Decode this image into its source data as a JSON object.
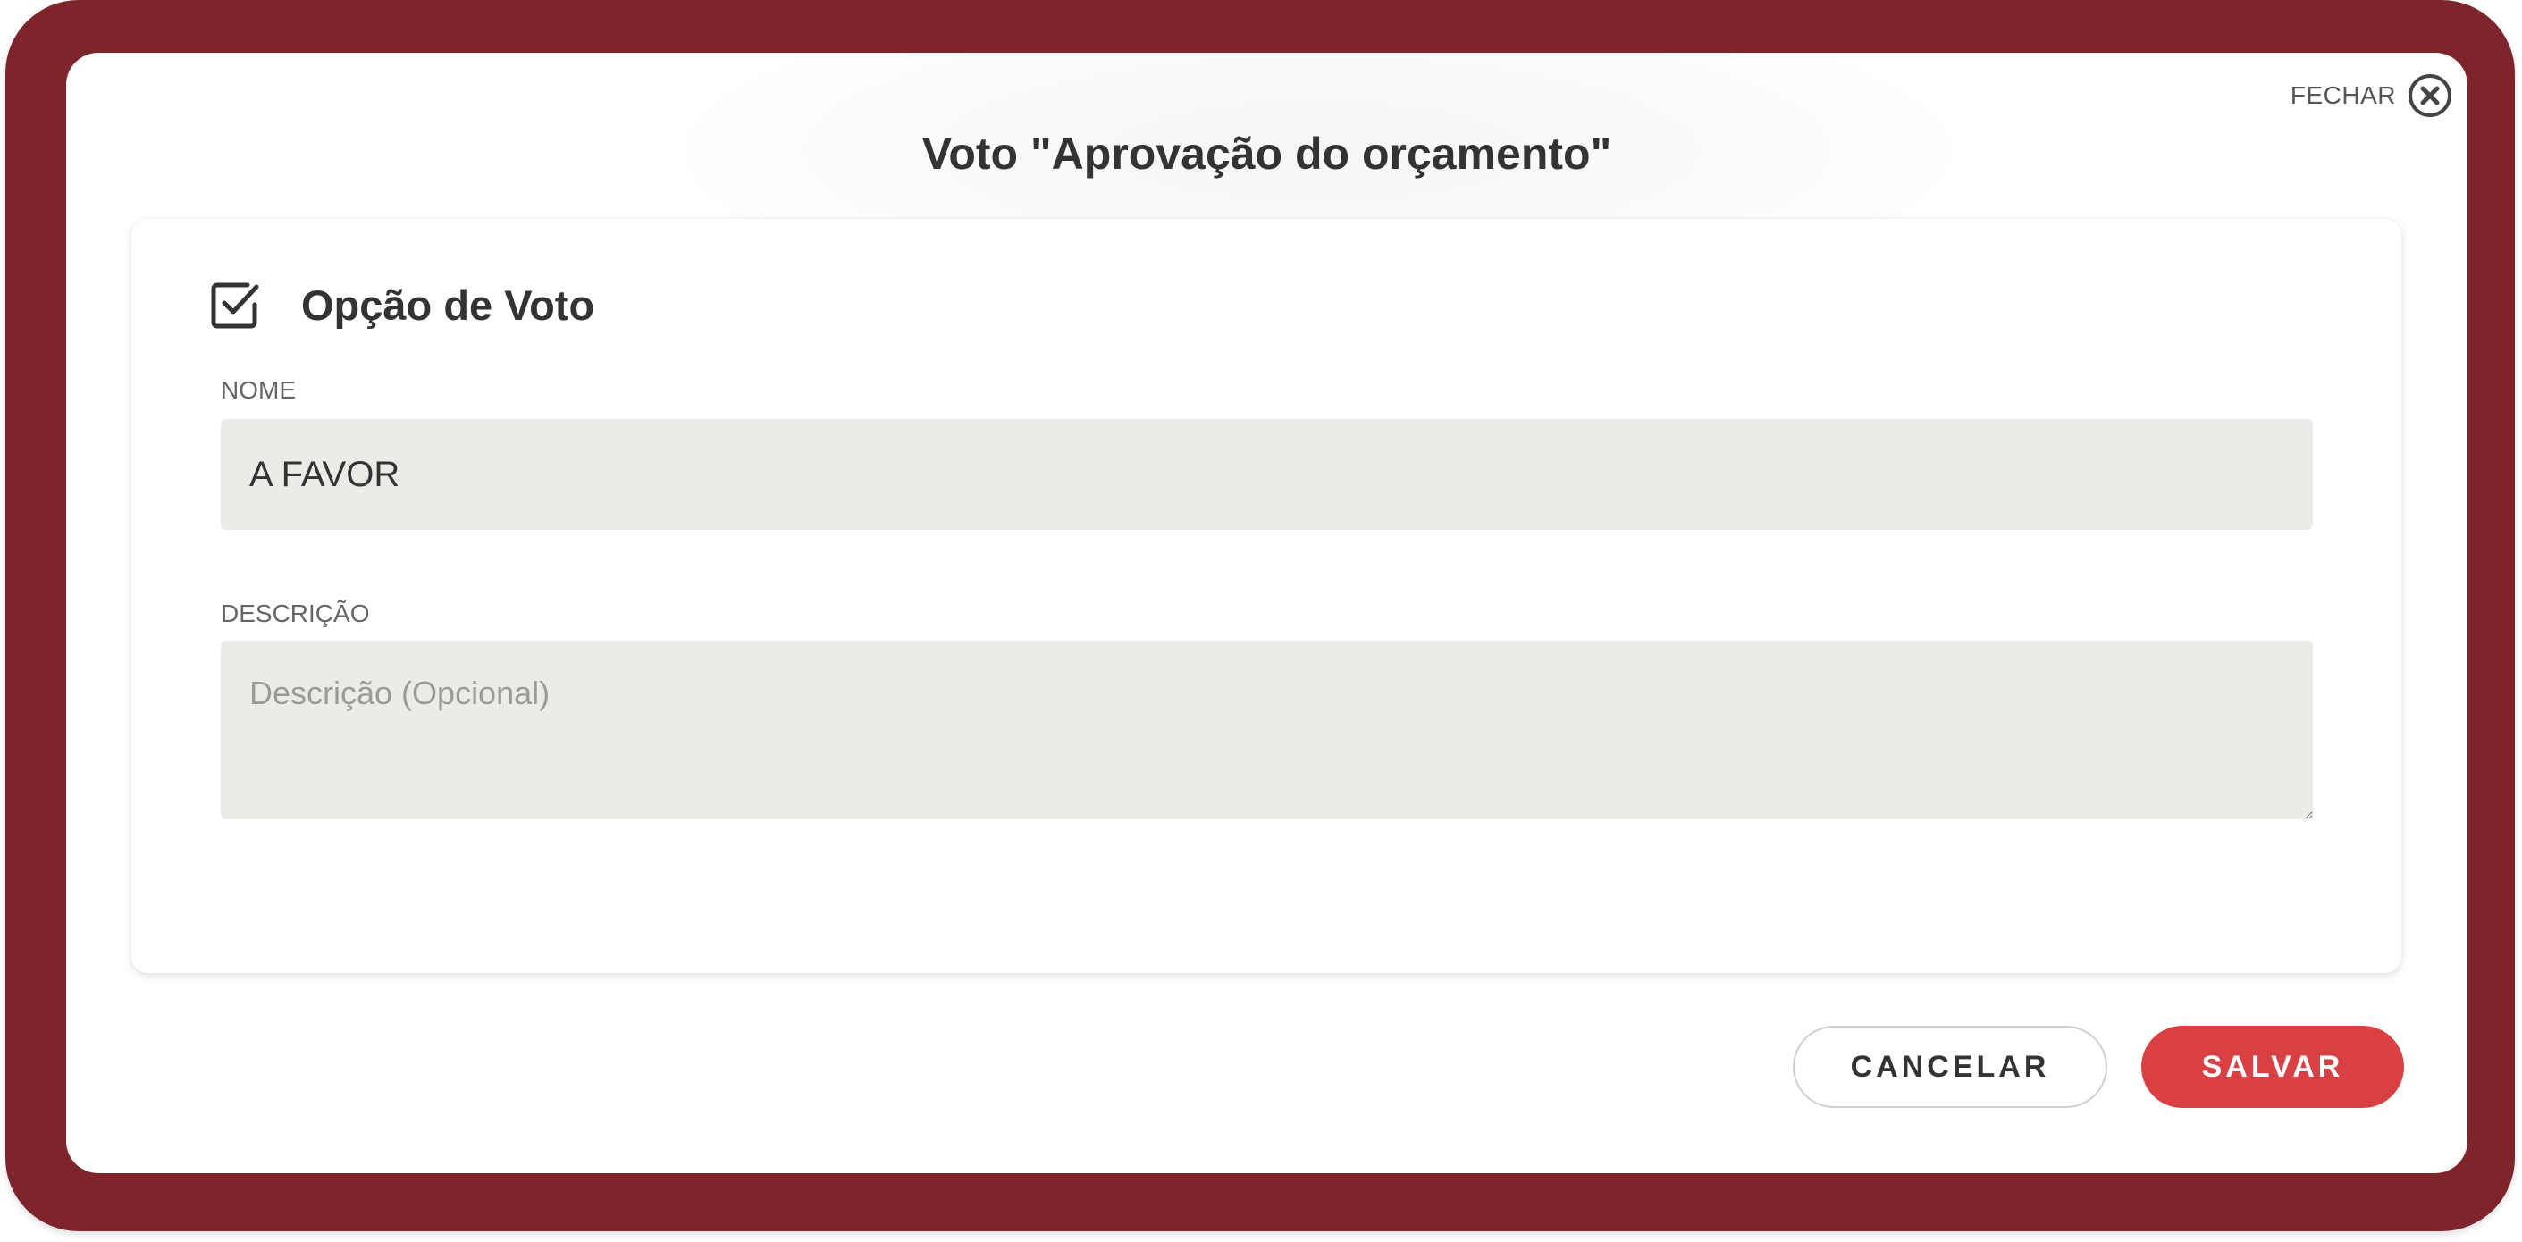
{
  "dialog": {
    "title": "Voto \"Aprovação do orçamento\"",
    "close_label": "FECHAR"
  },
  "section": {
    "title": "Opção de Voto",
    "icon": "checkbox-checked-icon"
  },
  "form": {
    "name_label": "NOME",
    "name_value": "A FAVOR",
    "description_label": "DESCRIÇÃO",
    "description_placeholder": "Descrição (Opcional)",
    "description_value": ""
  },
  "actions": {
    "cancel_label": "CANCELAR",
    "save_label": "SALVAR"
  },
  "colors": {
    "frame": "#7e242b",
    "primary": "#d94044",
    "field_background": "#ebebe8"
  }
}
